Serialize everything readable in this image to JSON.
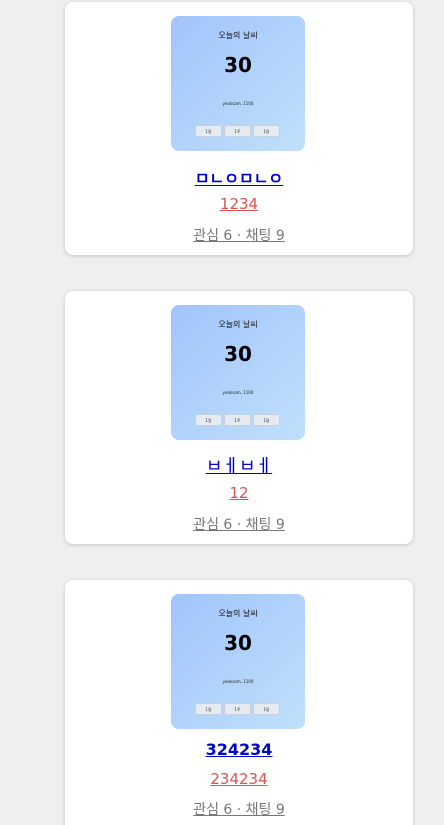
{
  "posts": [
    {
      "weather": {
        "title": "오늘의 날씨",
        "temp": "30",
        "location": "yeoksam, 1100",
        "buttons": [
          "1일",
          "1주",
          "1달"
        ]
      },
      "title": "ㅁㄴㅇㅁㄴㅇ",
      "price": "1234",
      "meta": "관심 6 · 채팅 9"
    },
    {
      "weather": {
        "title": "오늘의 날씨",
        "temp": "30",
        "location": "yeoksam, 1100",
        "buttons": [
          "1일",
          "1주",
          "1달"
        ]
      },
      "title": "ㅂㅔㅂㅔ",
      "price": "12",
      "meta": "관심 6 · 채팅 9"
    },
    {
      "weather": {
        "title": "오늘의 날씨",
        "temp": "30",
        "location": "yeoksam, 1100",
        "buttons": [
          "1일",
          "1주",
          "1달"
        ]
      },
      "title": "324234",
      "price": "234234",
      "meta": "관심 6 · 채팅 9"
    }
  ]
}
